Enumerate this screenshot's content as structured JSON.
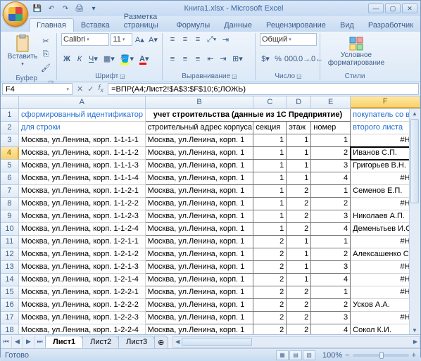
{
  "window": {
    "title": "Книга1.xlsx - Microsoft Excel"
  },
  "ribbon_tabs": [
    "Главная",
    "Вставка",
    "Разметка страницы",
    "Формулы",
    "Данные",
    "Рецензирование",
    "Вид",
    "Разработчик"
  ],
  "ribbon": {
    "clipboard": {
      "paste": "Вставить",
      "label": "Буфер обмена"
    },
    "font": {
      "name": "Calibri",
      "size": "11",
      "label": "Шрифт"
    },
    "align": {
      "label": "Выравнивание"
    },
    "number": {
      "format": "Общий",
      "label": "Число"
    },
    "styles": {
      "condfmt": "Условное форматирование",
      "label": "Стили"
    }
  },
  "namebox": "F4",
  "formula": "=ВПР(A4;Лист2!$A$3:$F$10;6;ЛОЖЬ)",
  "columns": [
    "A",
    "B",
    "C",
    "D",
    "E",
    "F"
  ],
  "chart_data": {
    "type": "table",
    "title_merged": "учет строительства (данные из 1С Предприятие)",
    "headers": {
      "A": "сформированный идентификатор для строки",
      "B": "строительный адрес корпуса",
      "C": "секция",
      "D": "этаж",
      "E": "номер на этаже",
      "F": "покупатель со второго листа"
    },
    "rows": [
      {
        "r": 3,
        "A": "Москва, ул.Ленина, корп. 1-1-1-1",
        "B": "Москва, ул.Ленина, корп. 1",
        "C": 1,
        "D": 1,
        "E": 1,
        "F": "#Н/Д"
      },
      {
        "r": 4,
        "A": "Москва, ул.Ленина, корп. 1-1-1-2",
        "B": "Москва, ул.Ленина, корп. 1",
        "C": 1,
        "D": 1,
        "E": 2,
        "F": "Иванов С.П."
      },
      {
        "r": 5,
        "A": "Москва, ул.Ленина, корп. 1-1-1-3",
        "B": "Москва, ул.Ленина, корп. 1",
        "C": 1,
        "D": 1,
        "E": 3,
        "F": "Григорьев В.Н."
      },
      {
        "r": 6,
        "A": "Москва, ул.Ленина, корп. 1-1-1-4",
        "B": "Москва, ул.Ленина, корп. 1",
        "C": 1,
        "D": 1,
        "E": 4,
        "F": "#Н/Д"
      },
      {
        "r": 7,
        "A": "Москва, ул.Ленина, корп. 1-1-2-1",
        "B": "Москва, ул.Ленина, корп. 1",
        "C": 1,
        "D": 2,
        "E": 1,
        "F": "Семенов Е.П."
      },
      {
        "r": 8,
        "A": "Москва, ул.Ленина, корп. 1-1-2-2",
        "B": "Москва, ул.Ленина, корп. 1",
        "C": 1,
        "D": 2,
        "E": 2,
        "F": "#Н/Д"
      },
      {
        "r": 9,
        "A": "Москва, ул.Ленина, корп. 1-1-2-3",
        "B": "Москва, ул.Ленина, корп. 1",
        "C": 1,
        "D": 2,
        "E": 3,
        "F": "Николаев А.П."
      },
      {
        "r": 10,
        "A": "Москва, ул.Ленина, корп. 1-1-2-4",
        "B": "Москва, ул.Ленина, корп. 1",
        "C": 1,
        "D": 2,
        "E": 4,
        "F": "Деменьтьев И.С."
      },
      {
        "r": 11,
        "A": "Москва, ул.Ленина, корп. 1-2-1-1",
        "B": "Москва, ул.Ленина, корп. 1",
        "C": 2,
        "D": 1,
        "E": 1,
        "F": "#Н/Д"
      },
      {
        "r": 12,
        "A": "Москва, ул.Ленина, корп. 1-2-1-2",
        "B": "Москва, ул.Ленина, корп. 1",
        "C": 2,
        "D": 1,
        "E": 2,
        "F": "Алексашенко С.Э."
      },
      {
        "r": 13,
        "A": "Москва, ул.Ленина, корп. 1-2-1-3",
        "B": "Москва, ул.Ленина, корп. 1",
        "C": 2,
        "D": 1,
        "E": 3,
        "F": "#Н/Д"
      },
      {
        "r": 14,
        "A": "Москва, ул.Ленина, корп. 1-2-1-4",
        "B": "Москва, ул.Ленина, корп. 1",
        "C": 2,
        "D": 1,
        "E": 4,
        "F": "#Н/Д"
      },
      {
        "r": 15,
        "A": "Москва, ул.Ленина, корп. 1-2-2-1",
        "B": "Москва, ул.Ленина, корп. 1",
        "C": 2,
        "D": 2,
        "E": 1,
        "F": "#Н/Д"
      },
      {
        "r": 16,
        "A": "Москва, ул.Ленина, корп. 1-2-2-2",
        "B": "Москва, ул.Ленина, корп. 1",
        "C": 2,
        "D": 2,
        "E": 2,
        "F": "Усков А.А."
      },
      {
        "r": 17,
        "A": "Москва, ул.Ленина, корп. 1-2-2-3",
        "B": "Москва, ул.Ленина, корп. 1",
        "C": 2,
        "D": 2,
        "E": 3,
        "F": "#Н/Д"
      },
      {
        "r": 18,
        "A": "Москва, ул.Ленина, корп. 1-2-2-4",
        "B": "Москва, ул.Ленина, корп. 1",
        "C": 2,
        "D": 2,
        "E": 4,
        "F": "Сокол К.И."
      }
    ]
  },
  "sheets": [
    "Лист1",
    "Лист2",
    "Лист3"
  ],
  "status": "Готово",
  "zoom": "100%"
}
